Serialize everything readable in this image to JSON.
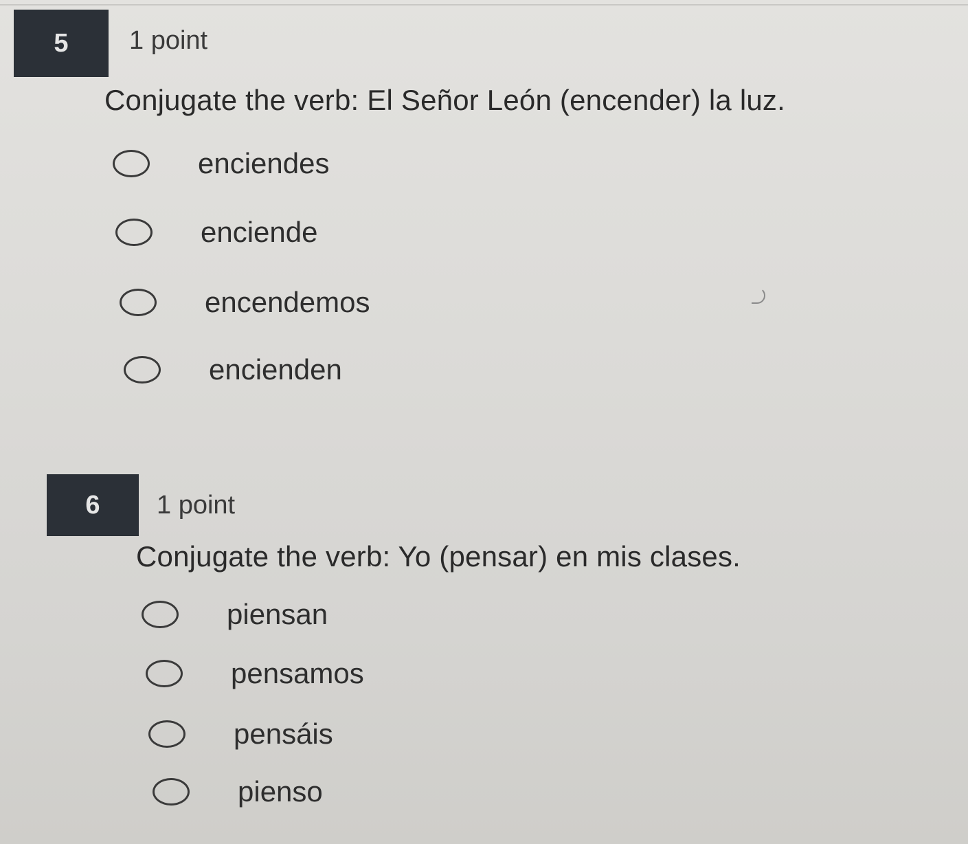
{
  "questions": [
    {
      "number": "5",
      "points": "1 point",
      "prompt": "Conjugate the verb: El Señor León (encender) la luz.",
      "options": [
        "enciendes",
        "enciende",
        "encendemos",
        "encienden"
      ]
    },
    {
      "number": "6",
      "points": "1 point",
      "prompt": "Conjugate the verb: Yo (pensar) en mis clases.",
      "options": [
        "piensan",
        "pensamos",
        "pensáis",
        "pienso"
      ]
    }
  ]
}
